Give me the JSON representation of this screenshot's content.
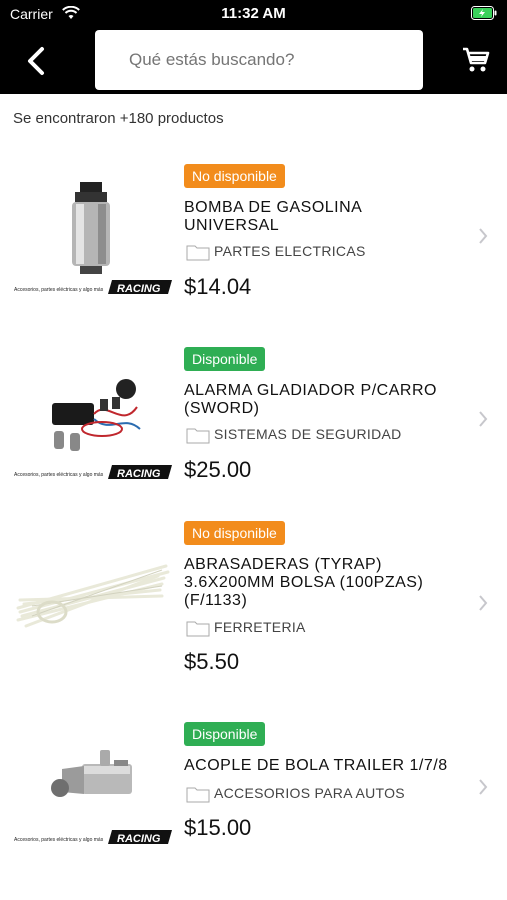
{
  "status_bar": {
    "carrier": "Carrier",
    "time": "11:32 AM",
    "wifi_icon": "wifi-icon",
    "battery_icon": "battery-charging-icon"
  },
  "nav": {
    "back_icon": "chevron-left-icon",
    "search_placeholder": "Qué estás buscando?",
    "cart_icon": "shopping-cart-icon"
  },
  "results": {
    "count_text": "Se encontraron +180 productos"
  },
  "colors": {
    "unavailable": "#f28c1c",
    "available": "#2fae54"
  },
  "products": [
    {
      "status": "No disponible",
      "name_line1": "BOMBA DE GASOLINA",
      "name_line2": "UNIVERSAL",
      "name_line3": "",
      "category": "PARTES ELECTRICAS",
      "price": "$14.04",
      "image": "fuel-pump-image"
    },
    {
      "status": "Disponible",
      "name_line1": "ALARMA GLADIADOR P/CARRO",
      "name_line2": "(SWORD)",
      "name_line3": "",
      "category": "SISTEMAS DE SEGURIDAD",
      "price": "$25.00",
      "image": "car-alarm-image"
    },
    {
      "status": "No disponible",
      "name_line1": "ABRASADERAS (TYRAP)",
      "name_line2": "3.6X200MM BOLSA (100PZAS)",
      "name_line3": "(F/1133)",
      "category": "FERRETERIA",
      "price": "$5.50",
      "image": "cable-ties-image"
    },
    {
      "status": "Disponible",
      "name_line1": "ACOPLE DE BOLA TRAILER 1/7/8",
      "name_line2": "",
      "name_line3": "",
      "category": "ACCESORIOS PARA AUTOS",
      "price": "$15.00",
      "image": "trailer-coupler-image"
    }
  ],
  "watermark": {
    "tagline": "Accesorios, partes eléctricas y algo más",
    "brand": "RACING"
  }
}
